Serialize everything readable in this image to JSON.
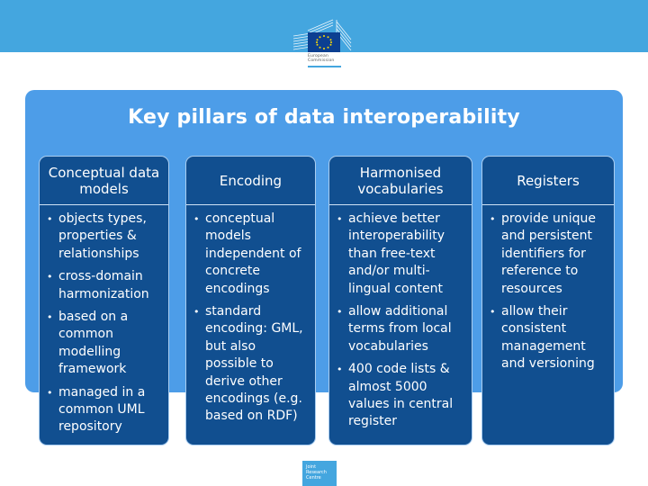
{
  "header": {
    "logo": {
      "icon": "european-commission-logo",
      "name_line1": "European",
      "name_line2": "Commission"
    }
  },
  "slide": {
    "title": "Key pillars of data interoperability",
    "pillars": [
      {
        "heading": "Conceptual data models",
        "bullets": [
          "objects types, properties & relationships",
          "cross-domain harmonization",
          "based on a common modelling framework",
          "managed in a common UML repository"
        ]
      },
      {
        "heading": "Encoding",
        "bullets": [
          "conceptual models independent of concrete encodings",
          "standard encoding: GML, but also possible to derive other encodings (e.g. based on RDF)"
        ]
      },
      {
        "heading": "Harmonised vocabularies",
        "bullets": [
          "achieve better interoperability than free-text and/or multi-lingual content",
          "allow additional terms from local vocabularies",
          "400 code lists & almost 5000 values in central register"
        ]
      },
      {
        "heading": "Registers",
        "bullets": [
          "provide unique and persistent identifiers for reference to resources",
          "allow their consistent management and versioning"
        ]
      }
    ]
  },
  "footer": {
    "logo": {
      "icon": "jrc-logo",
      "line1": "Joint",
      "line2": "Research",
      "line3": "Centre"
    }
  },
  "colors": {
    "top_band": "#44a6df",
    "panel": "#4d9de8",
    "card": "#114f90",
    "text": "#ffffff"
  }
}
